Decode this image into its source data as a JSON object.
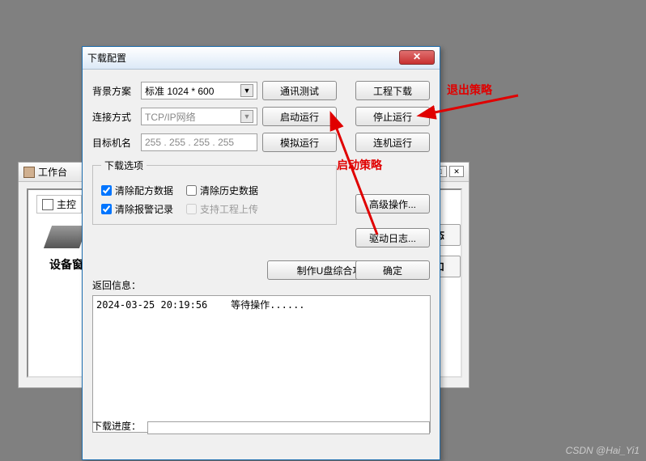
{
  "bg": {
    "title": "工作台",
    "inner_label": "主控",
    "device_label": "设备窗",
    "side_btns": [
      "组态",
      "窗口"
    ]
  },
  "dialog": {
    "title": "下载配置",
    "rows": {
      "bg_scheme_label": "背景方案",
      "bg_scheme_value": "标准 1024 * 600",
      "conn_label": "连接方式",
      "conn_value": "TCP/IP网络",
      "target_label": "目标机名",
      "target_value": "255 . 255 . 255 . 255"
    },
    "buttons": {
      "comm_test": "通讯测试",
      "start_run": "启动运行",
      "sim_run": "模拟运行",
      "project_download": "工程下载",
      "stop_run": "停止运行",
      "online_run": "连机运行",
      "advanced": "高级操作...",
      "driver_log": "驱动日志...",
      "ok": "确定",
      "make_usb": "制作U盘综合功能包"
    },
    "options": {
      "legend": "下载选项",
      "clear_recipe": "清除配方数据",
      "clear_history": "清除历史数据",
      "clear_alarm": "清除报警记录",
      "support_upload": "支持工程上传"
    },
    "return_label": "返回信息：",
    "log_text": "2024-03-25 20:19:56    等待操作......",
    "progress_label": "下载进度：",
    "close_x": "✕"
  },
  "annotations": {
    "exit_strategy": "退出策略",
    "start_strategy": "启动策略"
  },
  "watermark": "CSDN @Hai_Yi1"
}
